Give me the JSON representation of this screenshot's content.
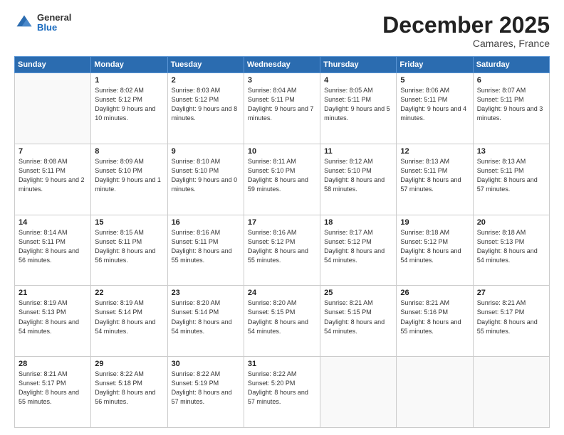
{
  "header": {
    "logo": {
      "general": "General",
      "blue": "Blue"
    },
    "title": "December 2025",
    "subtitle": "Camares, France"
  },
  "days_of_week": [
    "Sunday",
    "Monday",
    "Tuesday",
    "Wednesday",
    "Thursday",
    "Friday",
    "Saturday"
  ],
  "weeks": [
    [
      {
        "day": "",
        "sunrise": "",
        "sunset": "",
        "daylight": ""
      },
      {
        "day": "1",
        "sunrise": "Sunrise: 8:02 AM",
        "sunset": "Sunset: 5:12 PM",
        "daylight": "Daylight: 9 hours and 10 minutes."
      },
      {
        "day": "2",
        "sunrise": "Sunrise: 8:03 AM",
        "sunset": "Sunset: 5:12 PM",
        "daylight": "Daylight: 9 hours and 8 minutes."
      },
      {
        "day": "3",
        "sunrise": "Sunrise: 8:04 AM",
        "sunset": "Sunset: 5:11 PM",
        "daylight": "Daylight: 9 hours and 7 minutes."
      },
      {
        "day": "4",
        "sunrise": "Sunrise: 8:05 AM",
        "sunset": "Sunset: 5:11 PM",
        "daylight": "Daylight: 9 hours and 5 minutes."
      },
      {
        "day": "5",
        "sunrise": "Sunrise: 8:06 AM",
        "sunset": "Sunset: 5:11 PM",
        "daylight": "Daylight: 9 hours and 4 minutes."
      },
      {
        "day": "6",
        "sunrise": "Sunrise: 8:07 AM",
        "sunset": "Sunset: 5:11 PM",
        "daylight": "Daylight: 9 hours and 3 minutes."
      }
    ],
    [
      {
        "day": "7",
        "sunrise": "Sunrise: 8:08 AM",
        "sunset": "Sunset: 5:11 PM",
        "daylight": "Daylight: 9 hours and 2 minutes."
      },
      {
        "day": "8",
        "sunrise": "Sunrise: 8:09 AM",
        "sunset": "Sunset: 5:10 PM",
        "daylight": "Daylight: 9 hours and 1 minute."
      },
      {
        "day": "9",
        "sunrise": "Sunrise: 8:10 AM",
        "sunset": "Sunset: 5:10 PM",
        "daylight": "Daylight: 9 hours and 0 minutes."
      },
      {
        "day": "10",
        "sunrise": "Sunrise: 8:11 AM",
        "sunset": "Sunset: 5:10 PM",
        "daylight": "Daylight: 8 hours and 59 minutes."
      },
      {
        "day": "11",
        "sunrise": "Sunrise: 8:12 AM",
        "sunset": "Sunset: 5:10 PM",
        "daylight": "Daylight: 8 hours and 58 minutes."
      },
      {
        "day": "12",
        "sunrise": "Sunrise: 8:13 AM",
        "sunset": "Sunset: 5:11 PM",
        "daylight": "Daylight: 8 hours and 57 minutes."
      },
      {
        "day": "13",
        "sunrise": "Sunrise: 8:13 AM",
        "sunset": "Sunset: 5:11 PM",
        "daylight": "Daylight: 8 hours and 57 minutes."
      }
    ],
    [
      {
        "day": "14",
        "sunrise": "Sunrise: 8:14 AM",
        "sunset": "Sunset: 5:11 PM",
        "daylight": "Daylight: 8 hours and 56 minutes."
      },
      {
        "day": "15",
        "sunrise": "Sunrise: 8:15 AM",
        "sunset": "Sunset: 5:11 PM",
        "daylight": "Daylight: 8 hours and 56 minutes."
      },
      {
        "day": "16",
        "sunrise": "Sunrise: 8:16 AM",
        "sunset": "Sunset: 5:11 PM",
        "daylight": "Daylight: 8 hours and 55 minutes."
      },
      {
        "day": "17",
        "sunrise": "Sunrise: 8:16 AM",
        "sunset": "Sunset: 5:12 PM",
        "daylight": "Daylight: 8 hours and 55 minutes."
      },
      {
        "day": "18",
        "sunrise": "Sunrise: 8:17 AM",
        "sunset": "Sunset: 5:12 PM",
        "daylight": "Daylight: 8 hours and 54 minutes."
      },
      {
        "day": "19",
        "sunrise": "Sunrise: 8:18 AM",
        "sunset": "Sunset: 5:12 PM",
        "daylight": "Daylight: 8 hours and 54 minutes."
      },
      {
        "day": "20",
        "sunrise": "Sunrise: 8:18 AM",
        "sunset": "Sunset: 5:13 PM",
        "daylight": "Daylight: 8 hours and 54 minutes."
      }
    ],
    [
      {
        "day": "21",
        "sunrise": "Sunrise: 8:19 AM",
        "sunset": "Sunset: 5:13 PM",
        "daylight": "Daylight: 8 hours and 54 minutes."
      },
      {
        "day": "22",
        "sunrise": "Sunrise: 8:19 AM",
        "sunset": "Sunset: 5:14 PM",
        "daylight": "Daylight: 8 hours and 54 minutes."
      },
      {
        "day": "23",
        "sunrise": "Sunrise: 8:20 AM",
        "sunset": "Sunset: 5:14 PM",
        "daylight": "Daylight: 8 hours and 54 minutes."
      },
      {
        "day": "24",
        "sunrise": "Sunrise: 8:20 AM",
        "sunset": "Sunset: 5:15 PM",
        "daylight": "Daylight: 8 hours and 54 minutes."
      },
      {
        "day": "25",
        "sunrise": "Sunrise: 8:21 AM",
        "sunset": "Sunset: 5:15 PM",
        "daylight": "Daylight: 8 hours and 54 minutes."
      },
      {
        "day": "26",
        "sunrise": "Sunrise: 8:21 AM",
        "sunset": "Sunset: 5:16 PM",
        "daylight": "Daylight: 8 hours and 55 minutes."
      },
      {
        "day": "27",
        "sunrise": "Sunrise: 8:21 AM",
        "sunset": "Sunset: 5:17 PM",
        "daylight": "Daylight: 8 hours and 55 minutes."
      }
    ],
    [
      {
        "day": "28",
        "sunrise": "Sunrise: 8:21 AM",
        "sunset": "Sunset: 5:17 PM",
        "daylight": "Daylight: 8 hours and 55 minutes."
      },
      {
        "day": "29",
        "sunrise": "Sunrise: 8:22 AM",
        "sunset": "Sunset: 5:18 PM",
        "daylight": "Daylight: 8 hours and 56 minutes."
      },
      {
        "day": "30",
        "sunrise": "Sunrise: 8:22 AM",
        "sunset": "Sunset: 5:19 PM",
        "daylight": "Daylight: 8 hours and 57 minutes."
      },
      {
        "day": "31",
        "sunrise": "Sunrise: 8:22 AM",
        "sunset": "Sunset: 5:20 PM",
        "daylight": "Daylight: 8 hours and 57 minutes."
      },
      {
        "day": "",
        "sunrise": "",
        "sunset": "",
        "daylight": ""
      },
      {
        "day": "",
        "sunrise": "",
        "sunset": "",
        "daylight": ""
      },
      {
        "day": "",
        "sunrise": "",
        "sunset": "",
        "daylight": ""
      }
    ]
  ]
}
